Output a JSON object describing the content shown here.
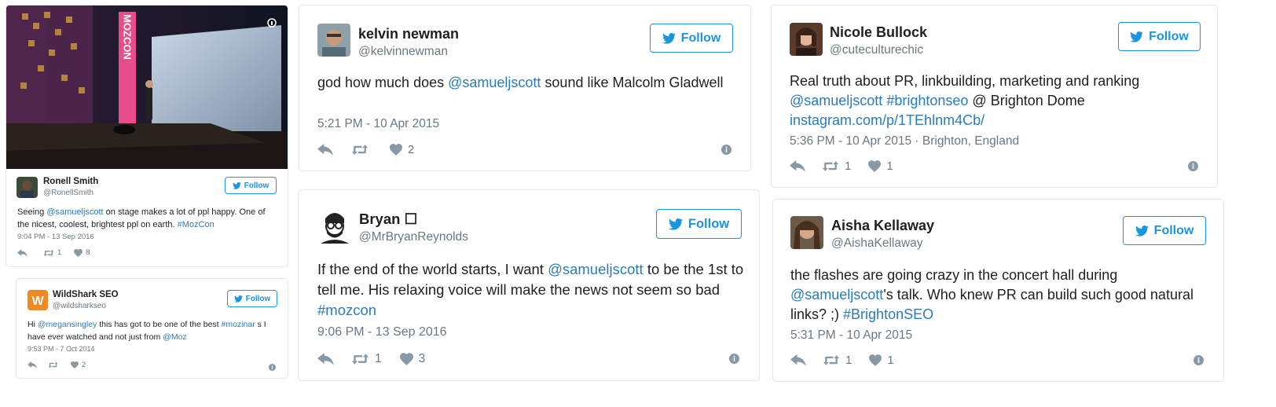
{
  "colors": {
    "link": "#2b7bb9",
    "follow": "#1b95e0",
    "meta": "#697882",
    "border": "#e1e8ed"
  },
  "tweets": [
    {
      "name": "Ronell Smith",
      "handle": "@RonellSmith",
      "follow": "Follow",
      "text": [
        {
          "t": "Seeing "
        },
        {
          "t": "@samueljscott",
          "link": true
        },
        {
          "t": " on stage makes a lot of ppl happy. One of the nicest, coolest, brightest ppl on earth. "
        },
        {
          "t": "#MozCon",
          "link": true
        }
      ],
      "date": "9:04 PM - 13 Sep 2016",
      "retweets": "1",
      "likes": "8",
      "photo_sign": "MOZCON"
    },
    {
      "name": "WildShark SEO",
      "handle": "@wildsharkseo",
      "follow": "Follow",
      "text": [
        {
          "t": "Hi "
        },
        {
          "t": "@megansingley",
          "link": true
        },
        {
          "t": " this has got to be one of the best "
        },
        {
          "t": "#mozinar",
          "link": true
        },
        {
          "t": " s I have ever watched and not just from "
        },
        {
          "t": "@Moz",
          "link": true
        }
      ],
      "date": "9:53 PM - 7 Oct 2014",
      "retweets": "",
      "likes": "2"
    },
    {
      "name": "kelvin newman",
      "handle": "@kelvinnewman",
      "follow": "Follow",
      "text": [
        {
          "t": "god how much does "
        },
        {
          "t": "@samueljscott",
          "link": true
        },
        {
          "t": " sound like Malcolm Gladwell"
        }
      ],
      "date": "5:21 PM - 10 Apr 2015",
      "retweets": "",
      "likes": "2"
    },
    {
      "name": "Bryan ☐",
      "handle": "@MrBryanReynolds",
      "follow": "Follow",
      "text": [
        {
          "t": "If the end of the world starts, I want "
        },
        {
          "t": "@samueljscott",
          "link": true
        },
        {
          "t": " to be the 1st to tell me. His relaxing voice will make the news not seem so bad "
        },
        {
          "t": "#mozcon",
          "link": true
        }
      ],
      "date": "9:06 PM - 13 Sep 2016",
      "retweets": "1",
      "likes": "3"
    },
    {
      "name": "Nicole Bullock",
      "handle": "@cuteculturechic",
      "follow": "Follow",
      "text": [
        {
          "t": "Real truth about PR, linkbuilding, marketing and ranking "
        },
        {
          "t": "@samueljscott",
          "link": true
        },
        {
          "t": " "
        },
        {
          "t": "#brightonseo",
          "link": true
        },
        {
          "t": " @ Brighton Dome "
        },
        {
          "t": "instagram.com/p/1TEhlnm4Cb/",
          "link": true
        }
      ],
      "date": "5:36 PM - 10 Apr 2015 · Brighton, England",
      "retweets": "1",
      "likes": "1"
    },
    {
      "name": "Aisha Kellaway",
      "handle": "@AishaKellaway",
      "follow": "Follow",
      "text": [
        {
          "t": "the flashes are going crazy in the concert hall during "
        },
        {
          "t": "@samueljscott",
          "link": true
        },
        {
          "t": "'s talk. Who knew PR can build such good natural links? ;) "
        },
        {
          "t": "#BrightonSEO",
          "link": true
        }
      ],
      "date": "5:31 PM - 10 Apr 2015",
      "retweets": "1",
      "likes": "1"
    }
  ]
}
